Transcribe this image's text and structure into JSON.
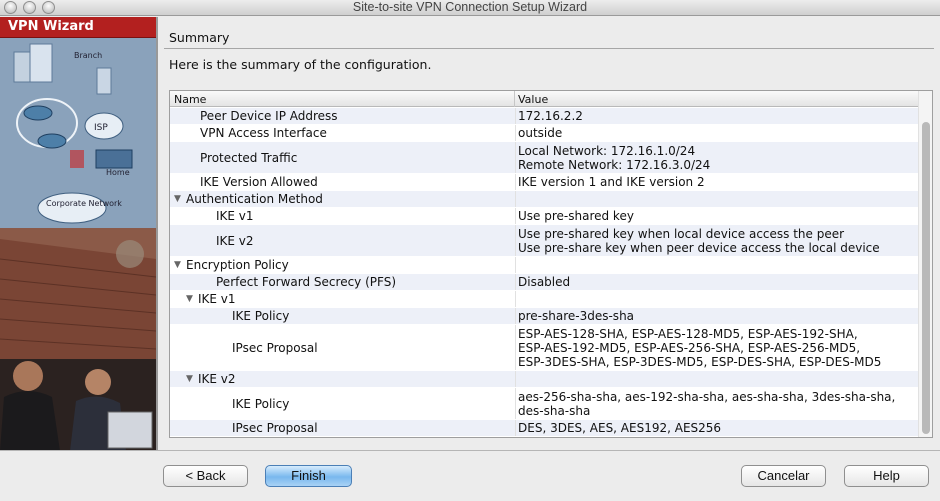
{
  "window": {
    "title": "Site-to-site VPN Connection Setup Wizard"
  },
  "sidebar": {
    "header": "VPN Wizard",
    "labels": {
      "branch": "Branch",
      "isp": "ISP",
      "home": "Home",
      "corporate": "Corporate Network"
    }
  },
  "content": {
    "section_title": "Summary",
    "intro": "Here is the summary of the configuration."
  },
  "table": {
    "columns": [
      "Name",
      "Value"
    ],
    "rows": [
      {
        "name": "Peer Device IP Address",
        "value": [
          "172.16.2.2"
        ],
        "level": 1,
        "toggle": false
      },
      {
        "name": "VPN Access Interface",
        "value": [
          "outside"
        ],
        "level": 1,
        "toggle": false
      },
      {
        "name": "Protected Traffic",
        "value": [
          "Local Network: 172.16.1.0/24",
          "Remote Network: 172.16.3.0/24"
        ],
        "level": 1,
        "toggle": false
      },
      {
        "name": "IKE Version Allowed",
        "value": [
          "IKE version 1 and IKE version 2"
        ],
        "level": 1,
        "toggle": false
      },
      {
        "name": "Authentication Method",
        "value": [],
        "level": 0,
        "toggle": true
      },
      {
        "name": "IKE v1",
        "value": [
          "Use pre-shared key"
        ],
        "level": 2,
        "toggle": false
      },
      {
        "name": "IKE v2",
        "value": [
          "Use pre-shared key when local device access the peer",
          "Use pre-share key when peer device access the local device"
        ],
        "level": 2,
        "toggle": false
      },
      {
        "name": "Encryption Policy",
        "value": [],
        "level": 0,
        "toggle": true
      },
      {
        "name": "Perfect Forward Secrecy (PFS)",
        "value": [
          "Disabled"
        ],
        "level": 2,
        "toggle": false
      },
      {
        "name": "IKE v1",
        "value": [],
        "level": 1,
        "toggle": true
      },
      {
        "name": "IKE Policy",
        "value": [
          "pre-share-3des-sha"
        ],
        "level": 3,
        "toggle": false
      },
      {
        "name": "IPsec Proposal",
        "value": [
          "ESP-AES-128-SHA, ESP-AES-128-MD5, ESP-AES-192-SHA,",
          "ESP-AES-192-MD5, ESP-AES-256-SHA, ESP-AES-256-MD5,",
          "ESP-3DES-SHA, ESP-3DES-MD5, ESP-DES-SHA, ESP-DES-MD5"
        ],
        "level": 3,
        "toggle": false
      },
      {
        "name": "IKE v2",
        "value": [],
        "level": 1,
        "toggle": true
      },
      {
        "name": "IKE Policy",
        "value": [
          "aes-256-sha-sha, aes-192-sha-sha, aes-sha-sha, 3des-sha-sha,",
          "des-sha-sha"
        ],
        "level": 3,
        "toggle": false
      },
      {
        "name": "IPsec Proposal",
        "value": [
          "DES, 3DES, AES, AES192, AES256"
        ],
        "level": 3,
        "toggle": false
      }
    ]
  },
  "buttons": {
    "back": "< Back",
    "finish": "Finish",
    "cancel": "Cancelar",
    "help": "Help"
  },
  "colors": {
    "header_red": "#b3201f",
    "alt_row": "#edf0f8",
    "primary_button": "#79b8ee"
  }
}
